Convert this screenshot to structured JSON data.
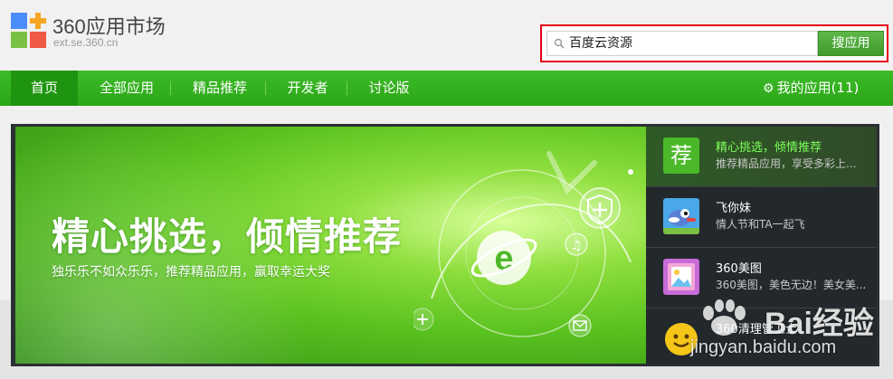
{
  "header": {
    "logo_title": "360应用市场",
    "logo_domain": "ext.se.360.cn"
  },
  "search": {
    "value": "百度云资源",
    "button_label": "搜应用"
  },
  "nav": {
    "items": [
      {
        "label": "首页",
        "active": true
      },
      {
        "label": "全部应用"
      },
      {
        "label": "精品推荐"
      },
      {
        "label": "开发者"
      },
      {
        "label": "讨论版"
      }
    ],
    "my_apps_label": "我的应用(11)",
    "my_apps_icon": "gear-icon"
  },
  "banner": {
    "title": "精心挑选，倾情推荐",
    "subtitle": "独乐乐不如众乐乐，推荐精品应用，赢取幸运大奖"
  },
  "side_list": [
    {
      "name": "精心挑选，倾情推荐",
      "desc": "推荐精品应用，享受多彩上...",
      "icon": "recommend-icon",
      "icon_text": "荐",
      "active": true
    },
    {
      "name": "飞你妹",
      "desc": "情人节和TA一起飞",
      "icon": "bird-icon"
    },
    {
      "name": "360美图",
      "desc": "360美图，美色无边！美女美...",
      "icon": "picture-icon"
    },
    {
      "name": "360清理管卫士",
      "desc": "",
      "icon": "smiley-icon"
    }
  ],
  "watermark": {
    "brand": "Bai经验",
    "url": "jingyan.baidu.com"
  },
  "colors": {
    "nav_green": "#2ba617",
    "search_border": "#e60012",
    "button_green": "#4aa935",
    "side_bg": "#23282c"
  }
}
